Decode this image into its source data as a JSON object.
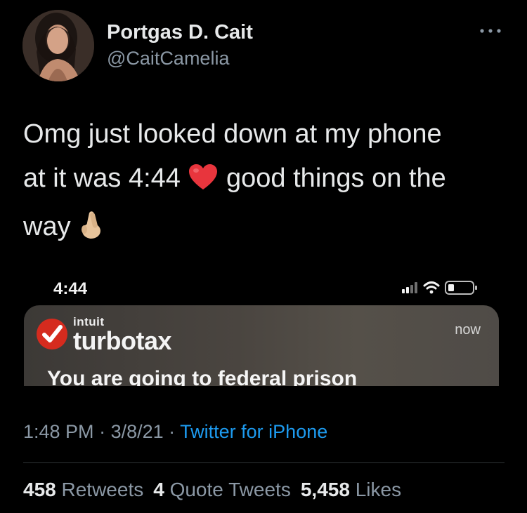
{
  "user": {
    "display_name": "Portgas D. Cait",
    "handle": "@CaitCamelia"
  },
  "tweet": {
    "line1": "Omg just looked down at my phone",
    "line2_before": "at it was 4:44",
    "line2_after": "good things on the",
    "line3": "way",
    "emoji_1": "red-heart-emoji",
    "emoji_2": "crossed-fingers-emoji"
  },
  "embedded_screenshot": {
    "status_time": "4:44",
    "notification": {
      "brand_small": "intuit",
      "brand": "turbotax",
      "time": "now",
      "message": "You are going to federal prison"
    }
  },
  "meta": {
    "time": "1:48 PM",
    "sep1": " · ",
    "date": "3/8/21",
    "sep2": " · ",
    "source": "Twitter for iPhone"
  },
  "stats": {
    "retweets_count": "458",
    "retweets_label": "Retweets",
    "quotes_count": "4",
    "quotes_label": "Quote Tweets",
    "likes_count": "5,458",
    "likes_label": "Likes"
  },
  "colors": {
    "background": "#000000",
    "text": "#e7e9ea",
    "muted": "#8b98a5",
    "link": "#1d9bf0",
    "turbotax_red": "#d52b1e"
  }
}
